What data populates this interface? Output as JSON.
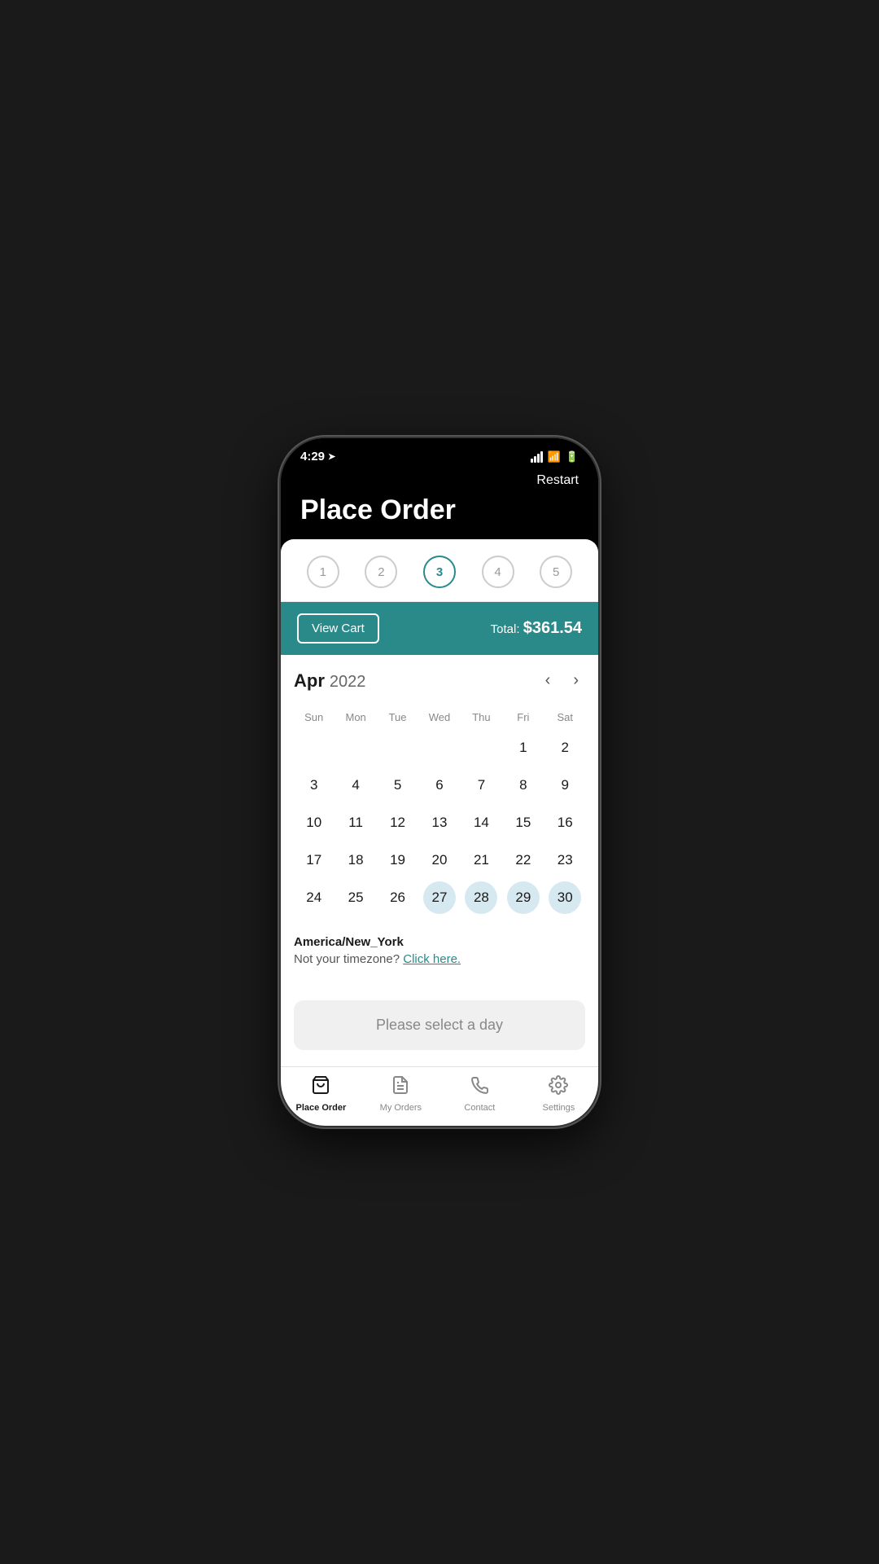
{
  "status": {
    "time": "4:29",
    "location_icon": "➤"
  },
  "header": {
    "restart_label": "Restart",
    "title": "Place Order"
  },
  "steps": [
    {
      "number": "1",
      "active": false
    },
    {
      "number": "2",
      "active": false
    },
    {
      "number": "3",
      "active": true
    },
    {
      "number": "4",
      "active": false
    },
    {
      "number": "5",
      "active": false
    }
  ],
  "cart_bar": {
    "view_cart_label": "View Cart",
    "total_label": "Total:",
    "total_amount": "$361.54"
  },
  "calendar": {
    "month": "Apr",
    "year": "2022",
    "days_of_week": [
      "Sun",
      "Mon",
      "Tue",
      "Wed",
      "Thu",
      "Fri",
      "Sat"
    ],
    "weeks": [
      [
        null,
        null,
        null,
        null,
        null,
        "1",
        "2"
      ],
      [
        "3",
        "4",
        "5",
        "6",
        "7",
        "8",
        "9"
      ],
      [
        "10",
        "11",
        "12",
        "13",
        "14",
        "15",
        "16"
      ],
      [
        "17",
        "18",
        "19",
        "20",
        "21",
        "22",
        "23"
      ],
      [
        "24",
        "25",
        "26",
        "27",
        "28",
        "29",
        "30"
      ]
    ],
    "selected_days": [
      "27",
      "28",
      "29",
      "30"
    ]
  },
  "timezone": {
    "name": "America/New_York",
    "question": "Not your timezone?",
    "link_label": "Click here."
  },
  "select_day": {
    "label": "Please select a day"
  },
  "bottom_nav": {
    "items": [
      {
        "id": "place-order",
        "label": "Place Order",
        "active": true
      },
      {
        "id": "my-orders",
        "label": "My Orders",
        "active": false
      },
      {
        "id": "contact",
        "label": "Contact",
        "active": false
      },
      {
        "id": "settings",
        "label": "Settings",
        "active": false
      }
    ]
  }
}
